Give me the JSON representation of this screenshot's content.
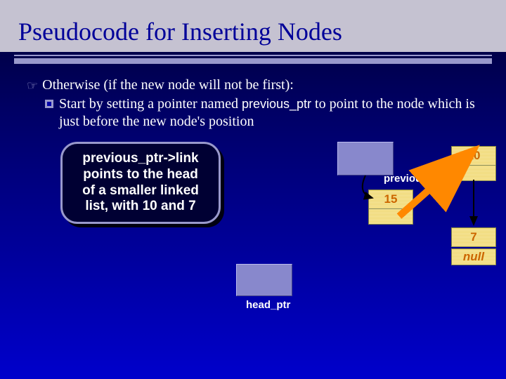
{
  "title": "Pseudocode for Inserting Nodes",
  "bullet": {
    "main": "Otherwise (if the new node will not be first):",
    "sub_prefix": "Start by setting a pointer named ",
    "sub_code": "previous_ptr",
    "sub_suffix": " to point to the node which is just before the new node's position"
  },
  "callout": {
    "l1": "previous_ptr->link",
    "l2": "points to the head",
    "l3": "of a smaller linked",
    "l4": "list, with 10 and 7"
  },
  "labels": {
    "previous_ptr": "previous_ptr",
    "head_ptr": "head_ptr"
  },
  "nodes": {
    "n15": "15",
    "n10": "10",
    "n7": "7",
    "nnull": "null"
  }
}
